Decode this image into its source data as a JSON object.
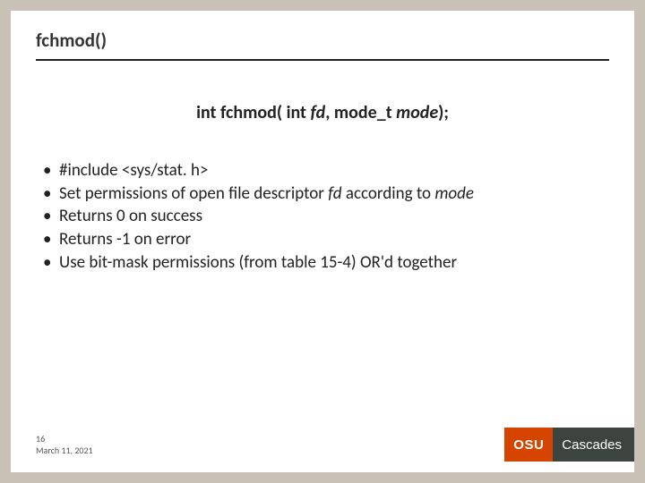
{
  "slide": {
    "title": "fchmod()",
    "signature": {
      "prefix": "int fchmod( int ",
      "arg1": "fd",
      "mid": ", mode_t ",
      "arg2": "mode",
      "suffix": ");"
    },
    "bullets": [
      {
        "text": "#include <sys/stat. h>"
      },
      {
        "pre": "Set permissions of open file descriptor ",
        "em1": "fd",
        "mid": " according to ",
        "em2": "mode"
      },
      {
        "text": "Returns 0 on success"
      },
      {
        "text": "Returns -1 on error"
      },
      {
        "text": "Use bit-mask permissions (from table 15-4) OR'd together"
      }
    ],
    "footer": {
      "page": "16",
      "date": "March 11, 2021"
    },
    "logo": {
      "brand": "OSU",
      "campus": "Cascades"
    }
  }
}
